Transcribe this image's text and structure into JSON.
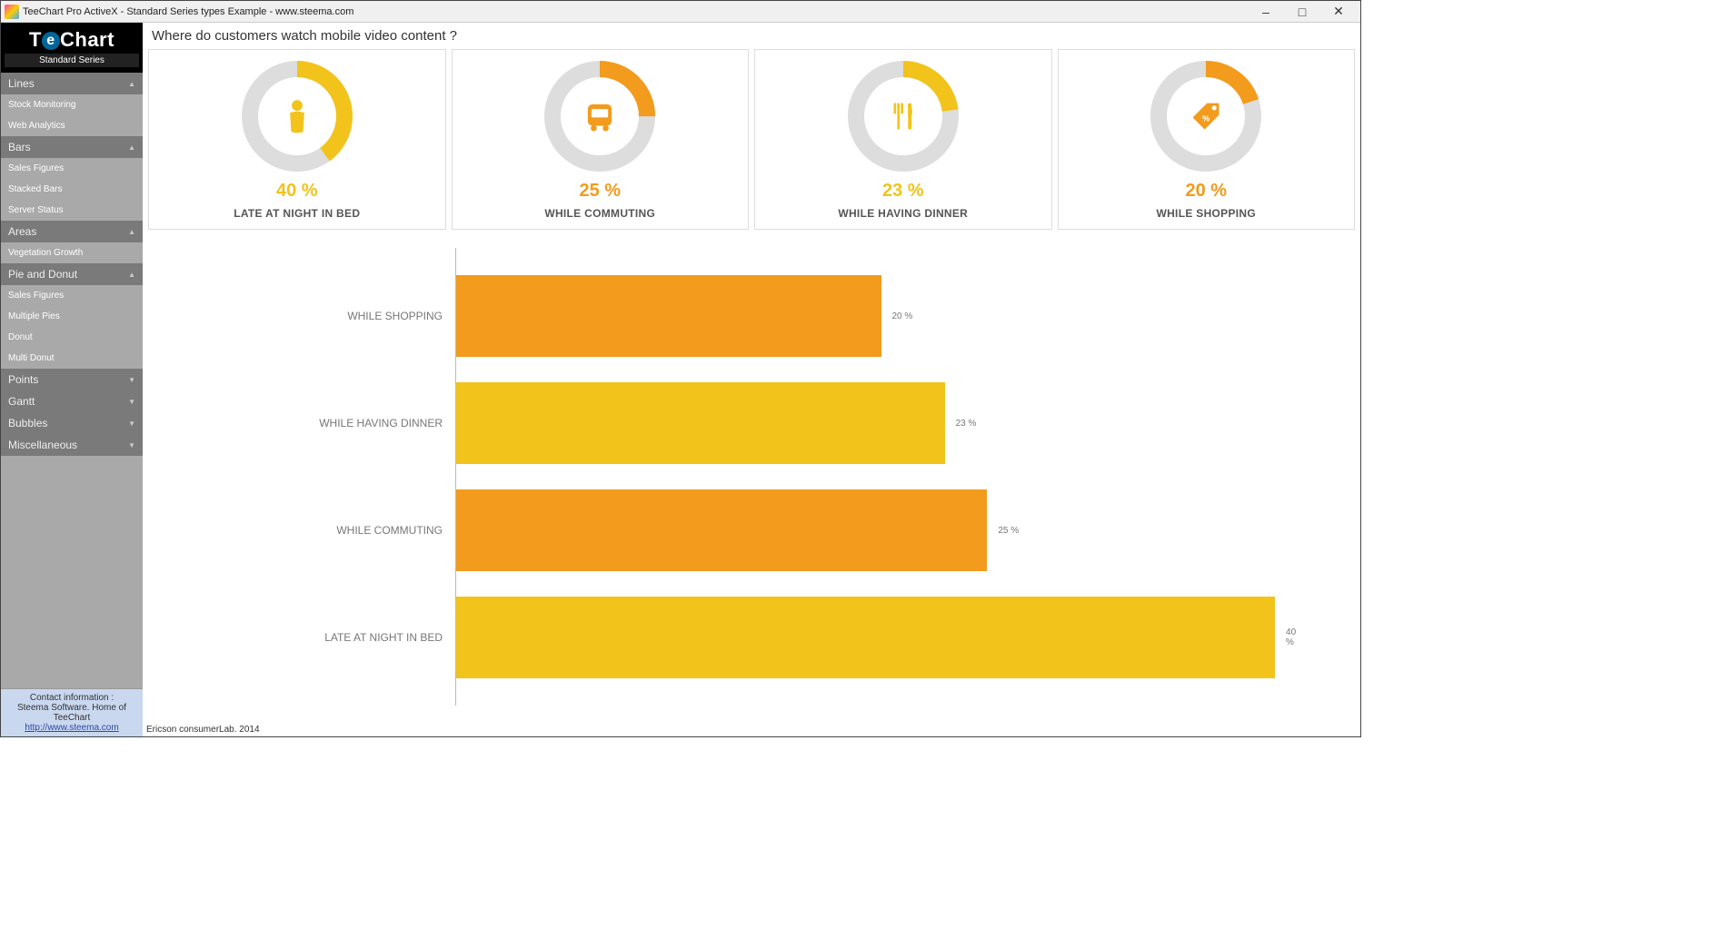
{
  "window": {
    "title": "TeeChart Pro ActiveX - Standard Series types Example - www.steema.com"
  },
  "logo": {
    "text": "TeeChart",
    "sub": "Standard Series"
  },
  "sidebar": {
    "groups": [
      {
        "label": "Lines",
        "expanded": true,
        "items": [
          "Stock Monitoring",
          "Web Analytics"
        ]
      },
      {
        "label": "Bars",
        "expanded": true,
        "items": [
          "Sales Figures",
          "Stacked Bars",
          "Server Status"
        ]
      },
      {
        "label": "Areas",
        "expanded": true,
        "items": [
          "Vegetation Growth"
        ]
      },
      {
        "label": "Pie and Donut",
        "expanded": true,
        "items": [
          "Sales Figures",
          "Multiple Pies",
          "Donut",
          "Multi Donut"
        ]
      },
      {
        "label": "Points",
        "expanded": false,
        "items": []
      },
      {
        "label": "Gantt",
        "expanded": false,
        "items": []
      },
      {
        "label": "Bubbles",
        "expanded": false,
        "items": []
      },
      {
        "label": "Miscellaneous",
        "expanded": false,
        "items": []
      }
    ]
  },
  "contact": {
    "line1": "Contact information :",
    "line2": "Steema Software. Home of TeeChart",
    "link": "http://www.steema.com"
  },
  "chart_title": "Where do customers watch mobile video content ?",
  "donuts": [
    {
      "icon": "person",
      "value": 40,
      "label": "LATE AT NIGHT IN BED",
      "color": "#f2c31b",
      "textcolor": "#f2c31b"
    },
    {
      "icon": "bus",
      "value": 25,
      "label": "WHILE COMMUTING",
      "color": "#f29b1c",
      "textcolor": "#f29b1c"
    },
    {
      "icon": "dinner",
      "value": 23,
      "label": "WHILE HAVING DINNER",
      "color": "#f2c31b",
      "textcolor": "#f2c31b"
    },
    {
      "icon": "tag",
      "value": 20,
      "label": "WHILE SHOPPING",
      "color": "#f29b1c",
      "textcolor": "#f29b1c"
    }
  ],
  "source": "Ericson consumerLab.   2014",
  "chart_data": {
    "type": "bar",
    "orientation": "horizontal",
    "title": "Where do customers watch mobile video content ?",
    "xlabel": "",
    "ylabel": "",
    "xlim": [
      0,
      40
    ],
    "categories": [
      "WHILE SHOPPING",
      "WHILE HAVING DINNER",
      "WHILE COMMUTING",
      "LATE AT NIGHT IN BED"
    ],
    "values": [
      20,
      23,
      25,
      40
    ],
    "value_labels": [
      "20 %",
      "23 %",
      "25 %",
      "40 %"
    ],
    "colors": [
      "#f29b1c",
      "#f2c31b",
      "#f29b1c",
      "#f2c31b"
    ],
    "source": "Ericson consumerLab.   2014"
  }
}
